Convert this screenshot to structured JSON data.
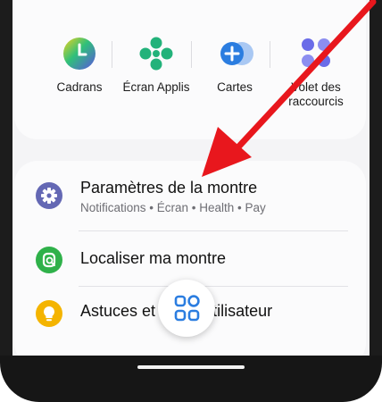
{
  "shortcuts": [
    {
      "label": "Cadrans",
      "icon": "watch-faces-icon"
    },
    {
      "label": "Écran Applis",
      "icon": "apps-screen-icon"
    },
    {
      "label": "Cartes",
      "icon": "tiles-icon"
    },
    {
      "label_line1": "Volet des",
      "label_line2": "raccourcis",
      "icon": "quick-panel-icon"
    }
  ],
  "settings_list": [
    {
      "title": "Paramètres de la montre",
      "subtitle": "Notifications • Écran • Health • Pay",
      "icon": "gear-icon",
      "color": "#6468b4"
    },
    {
      "title": "Localiser ma montre",
      "icon": "find-watch-icon",
      "color": "#2fb14a"
    },
    {
      "title": "Astuces et guide utilisateur",
      "icon": "lightbulb-icon",
      "color": "#f4b400"
    }
  ],
  "colors": {
    "accent_blue": "#2b7de0",
    "arrow_red": "#e8171d",
    "apps_green": "#22b27a"
  }
}
